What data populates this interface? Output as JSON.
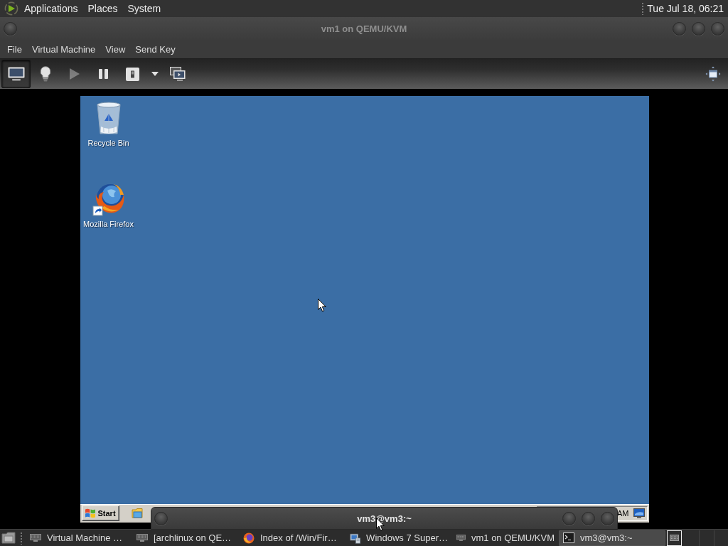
{
  "top_panel": {
    "menus": [
      "Applications",
      "Places",
      "System"
    ],
    "clock": "Tue Jul 18, 06:21"
  },
  "window": {
    "title": "vm1 on QEMU/KVM",
    "menu": [
      "File",
      "Virtual Machine",
      "View",
      "Send Key"
    ],
    "toolbar": [
      {
        "kind": "console",
        "selected": true,
        "disabled": false
      },
      {
        "kind": "details",
        "selected": false,
        "disabled": false
      },
      {
        "kind": "run",
        "selected": false,
        "disabled": true
      },
      {
        "kind": "pause",
        "selected": false,
        "disabled": false
      },
      {
        "kind": "shutdown",
        "selected": false,
        "disabled": false
      },
      {
        "kind": "shutdown-menu",
        "selected": false,
        "disabled": false
      },
      {
        "kind": "screens",
        "selected": false,
        "disabled": false
      },
      {
        "kind": "fullscreen",
        "selected": false,
        "disabled": false
      }
    ]
  },
  "guest": {
    "desktop_icons": [
      {
        "kind": "recycle-bin",
        "label": "Recycle Bin"
      },
      {
        "kind": "firefox",
        "label": "Mozilla Firefox"
      }
    ],
    "taskbar": {
      "start": "Start",
      "clock": "AM"
    }
  },
  "overlay_window": {
    "title": "vm3@vm3:~"
  },
  "taskbar": {
    "tasks": [
      {
        "kind": "vm",
        "label": "Virtual Machine …",
        "selected": false
      },
      {
        "kind": "vm",
        "label": "[archlinux on QE…",
        "selected": false
      },
      {
        "kind": "firefox",
        "label": "Index of /Win/Fir…",
        "selected": false
      },
      {
        "kind": "installer",
        "label": "Windows 7 Super…",
        "selected": false
      },
      {
        "kind": "vm",
        "label": "vm1 on QEMU/KVM",
        "selected": false
      },
      {
        "kind": "terminal",
        "label": "vm3@vm3:~",
        "selected": true
      }
    ],
    "workspaces": [
      {
        "selected": true
      }
    ]
  }
}
